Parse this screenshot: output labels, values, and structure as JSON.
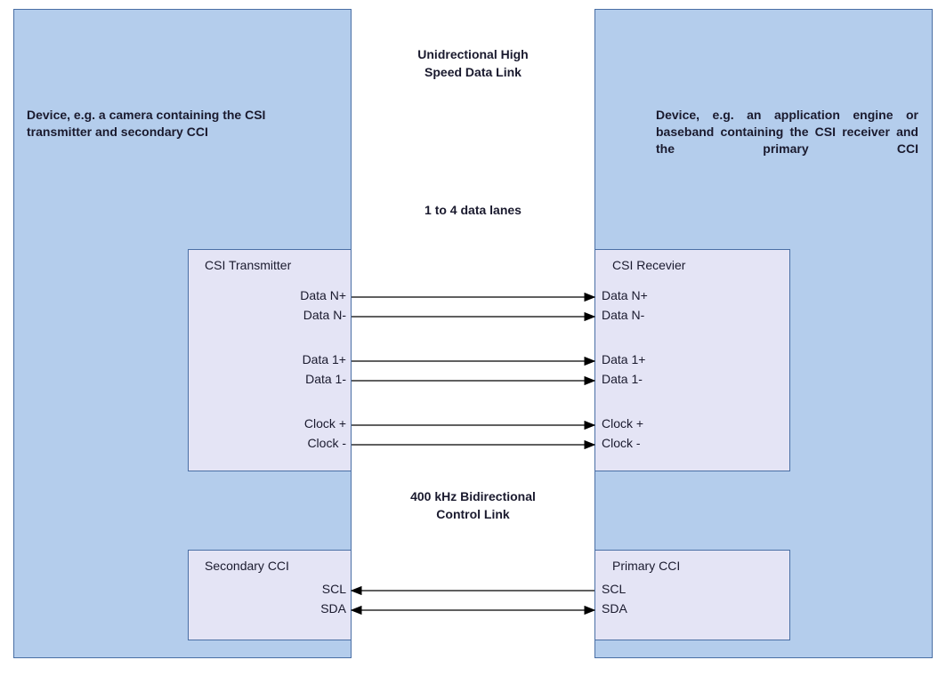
{
  "left_device": {
    "description": "Device, e.g. a camera containing the CSI transmitter and secondary CCI"
  },
  "right_device": {
    "description": "Device, e.g. an application engine or baseband containing the CSI receiver and the primary CCI"
  },
  "center_labels": {
    "top1": "Unidrectional High",
    "top2": "Speed Data Link",
    "lanes": "1 to 4 data lanes",
    "ctrl1": "400 kHz Bidirectional",
    "ctrl2": "Control Link"
  },
  "tx": {
    "title": "CSI Transmitter",
    "signals": [
      "Data N+",
      "Data N-",
      "Data 1+",
      "Data 1-",
      "Clock +",
      "Clock -"
    ]
  },
  "rx": {
    "title": "CSI Recevier",
    "signals": [
      "Data N+",
      "Data N-",
      "Data 1+",
      "Data 1-",
      "Clock +",
      "Clock -"
    ]
  },
  "cci_left": {
    "title": "Secondary CCI",
    "signals": [
      "SCL",
      "SDA"
    ]
  },
  "cci_right": {
    "title": "Primary CCI",
    "signals": [
      "SCL",
      "SDA"
    ]
  }
}
